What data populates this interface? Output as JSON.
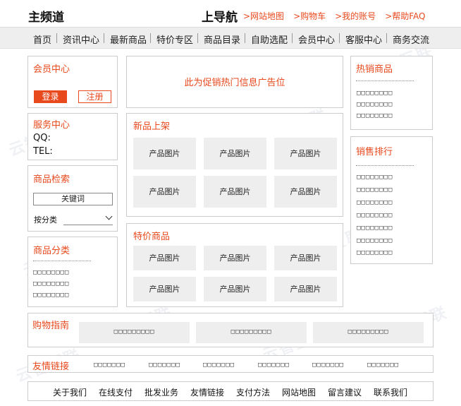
{
  "header": {
    "site_title": "主频道",
    "top_nav_title": "上导航",
    "links": [
      ">网站地图",
      ">购物车",
      ">我的账号",
      ">帮助FAQ"
    ]
  },
  "nav": {
    "items": [
      "首页",
      "资讯中心",
      "最新商品",
      "特价专区",
      "商品目录",
      "自助选配",
      "会员中心",
      "客服中心",
      "商务交流"
    ]
  },
  "member": {
    "title": "会员中心",
    "login": "登录",
    "register": "注册"
  },
  "service": {
    "title": "服务中心",
    "qq": "QQ:",
    "tel": "TEL:"
  },
  "search": {
    "title": "商品检索",
    "keyword": "关键词",
    "by_category": "按分类"
  },
  "categories": {
    "title": "商品分类",
    "items": [
      "□□□□□□□□",
      "□□□□□□□□",
      "□□□□□□□□"
    ]
  },
  "promo": {
    "text": "此为促销热门信息广告位"
  },
  "new_products": {
    "title": "新品上架",
    "items": [
      "产品图片",
      "产品图片",
      "产品图片",
      "产品图片",
      "产品图片",
      "产品图片"
    ]
  },
  "special_products": {
    "title": "特价商品",
    "items": [
      "产品图片",
      "产品图片",
      "产品图片",
      "产品图片",
      "产品图片",
      "产品图片"
    ]
  },
  "hot": {
    "title": "热销商品",
    "items": [
      "□□□□□□□□",
      "□□□□□□□□",
      "□□□□□□□□"
    ]
  },
  "ranking": {
    "title": "销售排行",
    "items": [
      "□□□□□□□□",
      "□□□□□□□□",
      "□□□□□□□□",
      "□□□□□□□□",
      "□□□□□□□□",
      "□□□□□□□□",
      "□□□□□□□□"
    ]
  },
  "guide": {
    "title": "购物指南",
    "items": [
      "□□□□□□□□□",
      "□□□□□□□□□",
      "□□□□□□□□□"
    ]
  },
  "friend_links": {
    "title": "友情链接",
    "items": [
      "□□□□□□□",
      "□□□□□□□",
      "□□□□□□□",
      "□□□□□□□",
      "□□□□□□□",
      "□□□□□□□"
    ]
  },
  "footer": {
    "links": [
      "关于我们",
      "在线支付",
      "批发业务",
      "友情链接",
      "支付方法",
      "网站地图",
      "留言建议",
      "联系我们"
    ]
  },
  "watermark": "云智互联",
  "colors": {
    "accent": "#e8491d",
    "panel_gray": "#eeeeee",
    "border": "#cccccc"
  }
}
